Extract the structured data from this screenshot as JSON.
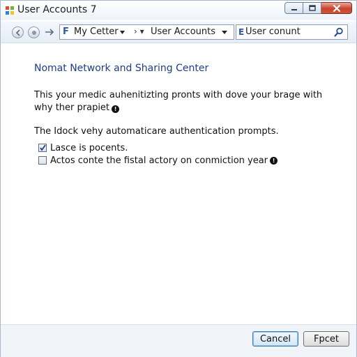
{
  "window": {
    "title": "User Accounts 7",
    "caption_buttons": [
      "minimize",
      "maximize",
      "close"
    ]
  },
  "nav": {
    "address_crumbs": [
      "My Cetter",
      "User Accounts"
    ],
    "crumb_separator": "› ▾",
    "folder_icon_text": "F",
    "search_mark": "E",
    "search_value": "User conunt"
  },
  "content": {
    "title": "Nomat Network and Sharing Center",
    "paragraph1": "This your medic auhenitizting pronts with dove your brage with why ther prapiet",
    "paragraph2": "The Idock vehy automaticare authentication prompts.",
    "options": [
      {
        "label": "Lasce is pocents.",
        "checked": true
      },
      {
        "label": "Actos conte the fistal actory on conmiction year",
        "checked": false,
        "has_info": true
      }
    ]
  },
  "footer": {
    "cancel_label": "Cancel",
    "second_label": "Fpcet"
  }
}
